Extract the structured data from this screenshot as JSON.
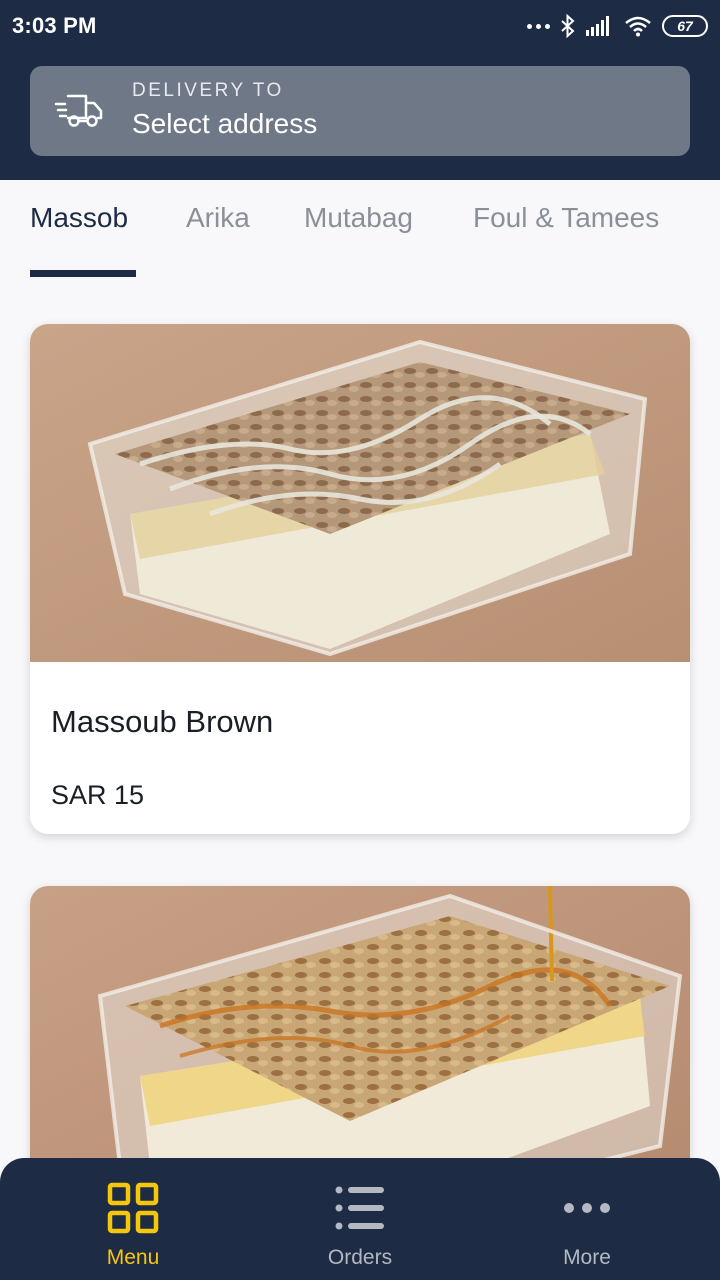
{
  "status_bar": {
    "time": "3:03 PM",
    "battery": "67"
  },
  "delivery": {
    "label": "DELIVERY TO",
    "address": "Select address"
  },
  "tabs": [
    {
      "label": "Massob",
      "active": true
    },
    {
      "label": "Arika",
      "active": false
    },
    {
      "label": "Mutabag",
      "active": false
    },
    {
      "label": "Foul & Tamees",
      "active": false
    }
  ],
  "products": [
    {
      "name": "Massoub Brown",
      "price": "SAR 15"
    },
    {
      "name": "",
      "price": ""
    }
  ],
  "bottom_nav": {
    "items": [
      {
        "label": "Menu",
        "icon": "grid-icon",
        "active": true
      },
      {
        "label": "Orders",
        "icon": "list-icon",
        "active": false
      },
      {
        "label": "More",
        "icon": "more-dots-icon",
        "active": false
      }
    ]
  },
  "colors": {
    "header": "#1e2b44",
    "accent": "#f6c60d",
    "address_box": "#6f7887"
  }
}
